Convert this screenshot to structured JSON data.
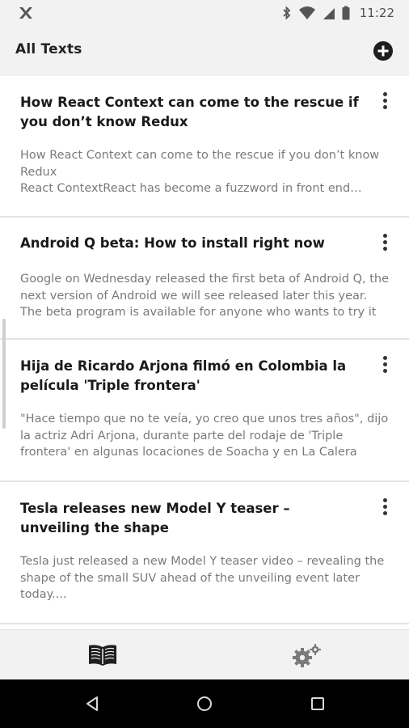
{
  "status_bar": {
    "time": "11:22",
    "icons": [
      "app-notification-icon",
      "bluetooth-icon",
      "wifi-icon",
      "cell-signal-icon",
      "battery-icon"
    ]
  },
  "app_bar": {
    "title": "All Texts",
    "add_icon": "add-circle-icon"
  },
  "texts": [
    {
      "title": "How React Context can come to the rescue if you don’t know Redux",
      "excerpt": "How React Context can come to the rescue if you don’t know Redux\nReact ContextReact has become a fuzzword in front end development"
    },
    {
      "title": "Android Q beta: How to install right now",
      "excerpt": "Google on Wednesday released the first beta of Android Q, the next version of Android we will see released later this year. The beta program is available for anyone who wants to try it"
    },
    {
      "title": "Hija de Ricardo Arjona filmó en Colombia la película 'Triple frontera'",
      "excerpt": "\"Hace tiempo que no te veía, yo creo que unos tres años\", dijo la actriz Adri Arjona, durante parte del rodaje de 'Triple frontera' en algunas locaciones de Soacha  y en La Calera"
    },
    {
      "title": "Tesla releases new Model Y teaser – unveiling the shape",
      "excerpt": "Tesla just released a new Model Y teaser video – revealing the shape of the small SUV ahead of the unveiling event later today...."
    }
  ],
  "bottom_nav": {
    "tabs": [
      {
        "icon": "book-icon"
      },
      {
        "icon": "settings-gears-icon"
      }
    ]
  },
  "system_nav": {
    "buttons": [
      "back-icon",
      "home-icon",
      "recents-icon"
    ]
  }
}
